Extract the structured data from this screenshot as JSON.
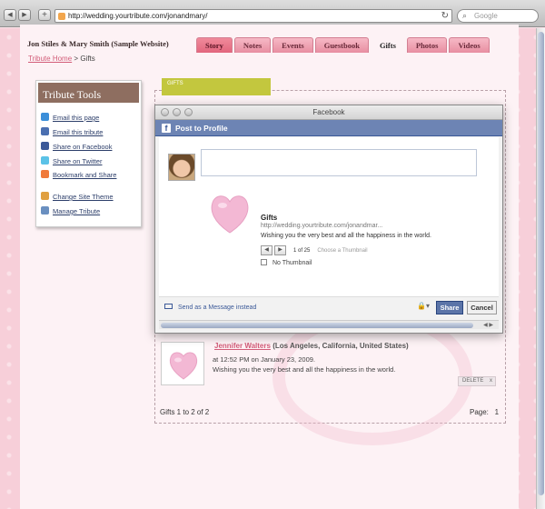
{
  "browser": {
    "url": "http://wedding.yourtribute.com/jonandmary/",
    "search_placeholder": "Google",
    "back": "◀",
    "forward": "▶",
    "add": "+"
  },
  "site": {
    "title": "Jon Stiles & Mary Smith (Sample Website)",
    "tabs": [
      {
        "label": "Story"
      },
      {
        "label": "Notes"
      },
      {
        "label": "Events"
      },
      {
        "label": "Guestbook"
      },
      {
        "label": "Gifts"
      },
      {
        "label": "Photos"
      },
      {
        "label": "Videos"
      }
    ],
    "breadcrumb": {
      "home": "Tribute Home",
      "sep": ">",
      "current": "Gifts"
    }
  },
  "tools": {
    "heading": "Tribute Tools",
    "items": [
      {
        "label": "Email this page",
        "icon": "email-page-icon",
        "color": "#3b8fd9"
      },
      {
        "label": "Email this tribute",
        "icon": "email-icon",
        "color": "#4a6fb0"
      },
      {
        "label": "Share on Facebook",
        "icon": "facebook-icon",
        "color": "#3b5998"
      },
      {
        "label": "Share on Twitter",
        "icon": "twitter-icon",
        "color": "#5bc2e7"
      },
      {
        "label": "Bookmark and Share",
        "icon": "bookmark-icon",
        "color": "#f07a3a"
      },
      {
        "label": "Change Site Theme",
        "icon": "theme-icon",
        "color": "#e0a040"
      },
      {
        "label": "Manage Tribute",
        "icon": "manage-icon",
        "color": "#6a8fc0"
      }
    ]
  },
  "gifts": {
    "label": "GIFTS",
    "entry": {
      "name": "Jennifer Walters",
      "location": "(Los Angeles, California, United States)",
      "time": "at 12:52 PM on January 23, 2009.",
      "message": "Wishing you the very best and all the happiness in the world.",
      "delete_label": "DELETE",
      "delete_x": "x"
    },
    "count": "Gifts 1 to 2 of 2",
    "page_label": "Page:",
    "page_num": "1"
  },
  "facebook": {
    "window_title": "Facebook",
    "header": "Post to Profile",
    "logo": "f",
    "attachment": {
      "title": "Gifts",
      "url": "http://wedding.yourtribute.com/jonandmar...",
      "description": "Wishing you the very best and all the happiness in the world.",
      "counter": "1 of 25",
      "choose": "Choose a Thumbnail",
      "no_thumb": "No Thumbnail"
    },
    "send_message": "Send as a Message instead",
    "share": "Share",
    "cancel": "Cancel",
    "accent": "#3b5998"
  }
}
